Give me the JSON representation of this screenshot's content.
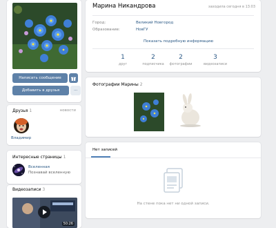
{
  "profile": {
    "name": "Марина Никандрова",
    "last_seen": "заходила сегодня в 13:03",
    "info": [
      {
        "label": "Город:",
        "value": "Великий Новгород"
      },
      {
        "label": "Образование:",
        "value": "НовГУ"
      }
    ],
    "show_more": "Показать подробную информацию",
    "counters": [
      {
        "value": "1",
        "label": "друг"
      },
      {
        "value": "2",
        "label": "подписчика"
      },
      {
        "value": "2",
        "label": "фотографии"
      },
      {
        "value": "3",
        "label": "видеозаписи"
      }
    ]
  },
  "actions": {
    "message": "Написать сообщение",
    "gift_icon": "gift-icon",
    "add_friend": "Добавить в друзья",
    "more": "···"
  },
  "friends": {
    "title": "Друзья",
    "count": "1",
    "link": "новости",
    "items": [
      {
        "name": "Владимир"
      }
    ]
  },
  "interests": {
    "title": "Интересные страницы",
    "count": "1",
    "items": [
      {
        "name": "Вселенная",
        "description": "Познавай вселенную"
      }
    ]
  },
  "videos": {
    "title": "Видеозаписи",
    "count": "3",
    "duration": "50:26"
  },
  "photos": {
    "title": "Фотографии Марины",
    "count": "2"
  },
  "wall": {
    "tab": "Нет записей",
    "empty_text": "На стене пока нет ни одной записи."
  },
  "colors": {
    "background": "#edeef0",
    "button": "#5e81a8",
    "link": "#2a5885"
  }
}
